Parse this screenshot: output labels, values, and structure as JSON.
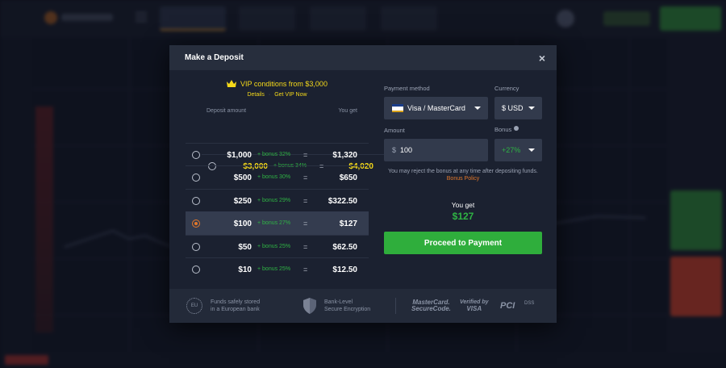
{
  "modal": {
    "title": "Make a Deposit",
    "close_label": "×"
  },
  "vip": {
    "headline": "VIP conditions from $3,000",
    "details_link": "Details",
    "separator": "·",
    "get_vip_link": "Get VIP Now"
  },
  "table": {
    "col_deposit": "Deposit amount",
    "col_youget": "You get",
    "equals": "=",
    "rows": [
      {
        "amount": "$3,000",
        "bonus": "+ bonus 34%",
        "result": "$4,020",
        "vip": true,
        "selected": false
      },
      {
        "amount": "$1,000",
        "bonus": "+ bonus 32%",
        "result": "$1,320",
        "vip": false,
        "selected": false
      },
      {
        "amount": "$500",
        "bonus": "+ bonus 30%",
        "result": "$650",
        "vip": false,
        "selected": false
      },
      {
        "amount": "$250",
        "bonus": "+ bonus 29%",
        "result": "$322.50",
        "vip": false,
        "selected": false
      },
      {
        "amount": "$100",
        "bonus": "+ bonus 27%",
        "result": "$127",
        "vip": false,
        "selected": true
      },
      {
        "amount": "$50",
        "bonus": "+ bonus 25%",
        "result": "$62.50",
        "vip": false,
        "selected": false
      },
      {
        "amount": "$10",
        "bonus": "+ bonus 25%",
        "result": "$12.50",
        "vip": false,
        "selected": false
      }
    ]
  },
  "form": {
    "payment_label": "Payment method",
    "payment_value": "Visa / MasterCard",
    "currency_label": "Currency",
    "currency_value": "$ USD",
    "amount_label": "Amount",
    "amount_prefix": "$",
    "amount_value": "100",
    "bonus_label": "Bonus",
    "bonus_value": "+27%",
    "note": "You may reject the bonus at any time after depositing funds.",
    "policy_link": "Bonus Policy",
    "youget_label": "You get",
    "youget_value": "$127",
    "proceed_label": "Proceed to Payment"
  },
  "footer": {
    "eu_badge": "EU",
    "funds_text_1": "Funds safely stored",
    "funds_text_2": "in a European bank",
    "security_text_1": "Bank-Level",
    "security_text_2": "Secure Encryption",
    "mastercard_1": "MasterCard.",
    "mastercard_2": "SecureCode.",
    "visa_1": "Verified by",
    "visa_2": "VISA",
    "pci": "PCI",
    "pci_sub": "DSS"
  },
  "colors": {
    "accent_green": "#2fae3c",
    "vip_yellow": "#f5d91a",
    "selected_orange": "#e3782a",
    "bonus_green": "#2fb344"
  }
}
